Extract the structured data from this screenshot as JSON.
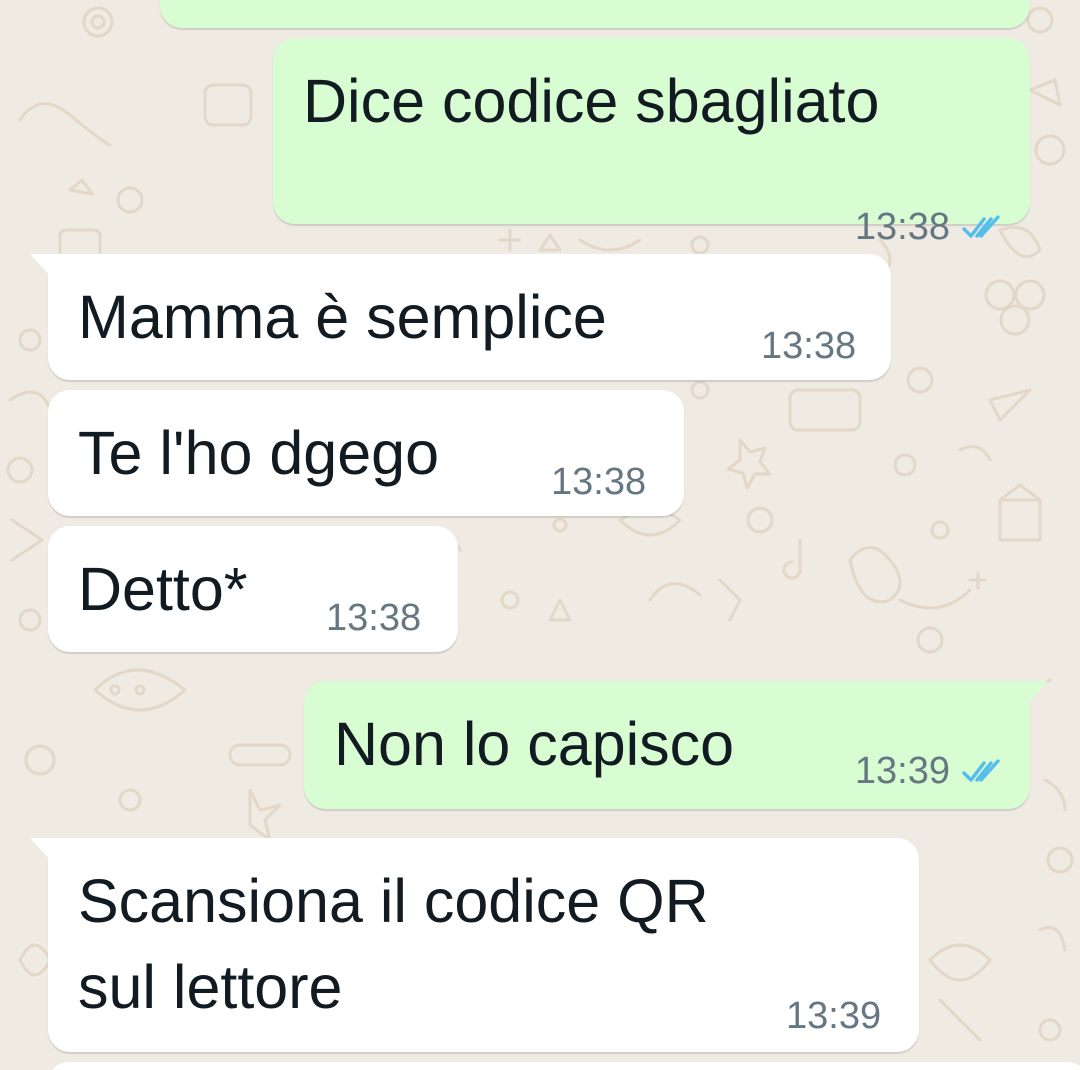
{
  "chat": {
    "messages": [
      {
        "direction": "out",
        "text": "Dice codice sbagliato",
        "time": "13:38",
        "status": "read-double-check-icon"
      },
      {
        "direction": "in",
        "text": "Mamma è semplice",
        "time": "13:38"
      },
      {
        "direction": "in",
        "text": "Te l'ho dgego",
        "time": "13:38"
      },
      {
        "direction": "in",
        "text": "Detto*",
        "time": "13:38"
      },
      {
        "direction": "out",
        "text": "Non lo capisco",
        "time": "13:39",
        "status": "read-double-check-icon"
      },
      {
        "direction": "in",
        "text_lines": [
          "Scansiona il codice QR",
          "sul lettore"
        ],
        "time": "13:39"
      }
    ]
  },
  "colors": {
    "background": "#efeae2",
    "outgoing_bubble": "#d9fdd3",
    "incoming_bubble": "#ffffff",
    "text": "#111b21",
    "meta": "#667781",
    "read_ticks": "#53bdeb"
  }
}
